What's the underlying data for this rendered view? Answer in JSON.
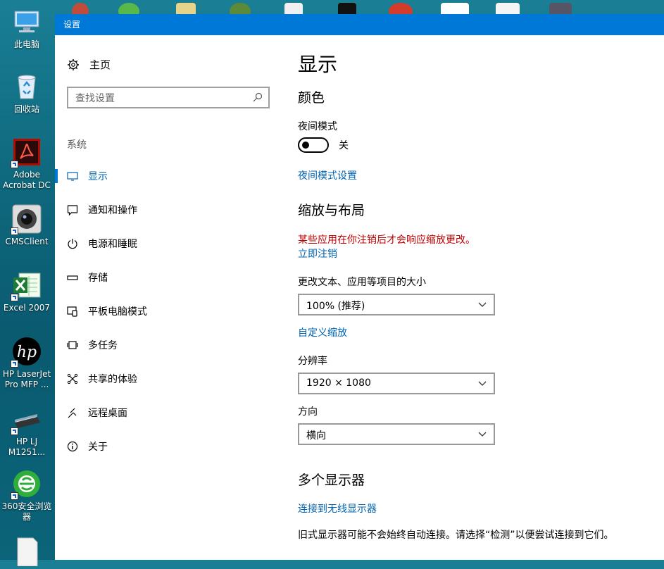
{
  "window": {
    "title": "设置"
  },
  "desktop": {
    "icons": [
      {
        "label": "此电脑",
        "icon": "computer-icon"
      },
      {
        "label": "回收站",
        "icon": "recycle-bin-icon"
      },
      {
        "label": "Adobe Acrobat DC",
        "icon": "acrobat-icon"
      },
      {
        "label": "CMSClient",
        "icon": "camera-icon"
      },
      {
        "label": "Excel 2007",
        "icon": "excel-icon"
      },
      {
        "label": "HP LaserJet Pro MFP ...",
        "icon": "hp-icon"
      },
      {
        "label": "HP LJ M1251...",
        "icon": "scanner-icon"
      },
      {
        "label": "360安全浏览器",
        "icon": "browser-360-icon"
      }
    ]
  },
  "sidebar": {
    "home": "主页",
    "search_placeholder": "查找设置",
    "section": "系统",
    "items": [
      {
        "label": "显示",
        "icon": "monitor-icon"
      },
      {
        "label": "通知和操作",
        "icon": "message-icon"
      },
      {
        "label": "电源和睡眠",
        "icon": "power-icon"
      },
      {
        "label": "存储",
        "icon": "storage-icon"
      },
      {
        "label": "平板电脑模式",
        "icon": "tablet-icon"
      },
      {
        "label": "多任务",
        "icon": "multitask-icon"
      },
      {
        "label": "共享的体验",
        "icon": "share-icon"
      },
      {
        "label": "远程桌面",
        "icon": "remote-icon"
      },
      {
        "label": "关于",
        "icon": "info-icon"
      }
    ]
  },
  "content": {
    "title": "显示",
    "color_heading": "颜色",
    "night_mode_label": "夜间模式",
    "night_mode_state": "关",
    "night_mode_settings": "夜间模式设置",
    "scale_heading": "缩放与布局",
    "warning": "某些应用在你注销后才会响应缩放更改。",
    "logout_now": "立即注销",
    "size_label": "更改文本、应用等项目的大小",
    "size_value": "100% (推荐)",
    "custom_scale": "自定义缩放",
    "resolution_label": "分辨率",
    "resolution_value": "1920 × 1080",
    "orientation_label": "方向",
    "orientation_value": "横向",
    "multi_heading": "多个显示器",
    "wireless_link": "连接到无线显示器",
    "old_monitor_text": "旧式显示器可能不会始终自动连接。请选择“检测”以便尝试连接到它们。"
  },
  "colors": {
    "accent": "#0078d7",
    "link": "#0063b1",
    "warning": "#c00000"
  }
}
